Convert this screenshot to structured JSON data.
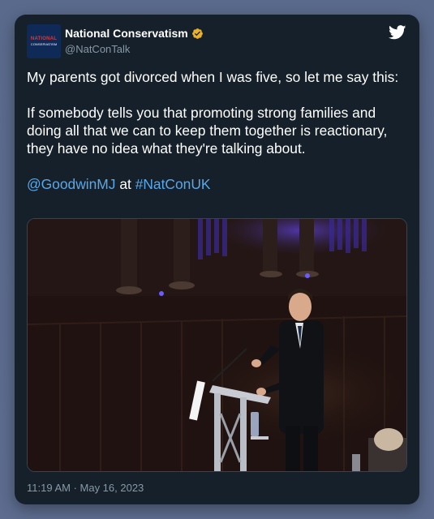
{
  "tweet": {
    "author": {
      "display_name": "National Conservatism",
      "handle": "@NatConTalk",
      "verified": true,
      "verified_color": "#e8b22b",
      "avatar": {
        "line1": "NATIONAL",
        "line2": "CONSERVATISM",
        "bg_color": "#0f2a57",
        "accent_color": "#d63b3b"
      }
    },
    "text": {
      "paragraph1": "My parents got divorced when I was five, so let me say this:",
      "paragraph2": "If somebody tells you that promoting strong families and doing all that we can to keep them together is reactionary, they have no idea what they're talking about.",
      "mention": "@GoodwinMJ",
      "connector": "at",
      "hashtag": "#NatConUK"
    },
    "media": {
      "description_icon": "photo-speaker-at-podium"
    },
    "timestamp": "11:19 AM · May 16, 2023"
  },
  "colors": {
    "background": "#5a6a8c",
    "card": "#15202b",
    "text": "#ffffff",
    "muted": "#8899a6",
    "link": "#5aa8e8",
    "twitter_blue": "#ffffff"
  },
  "icons": {
    "brand": "twitter-bird-icon",
    "verified": "verified-badge-icon"
  }
}
